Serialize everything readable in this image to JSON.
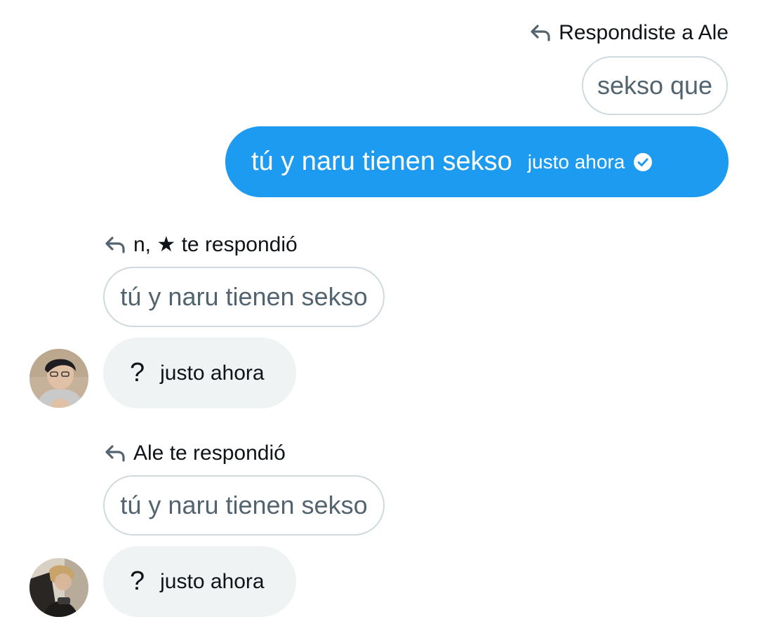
{
  "outgoing": {
    "reply_label": "Respondiste a Ale",
    "quoted_text": "sekso que",
    "message": "tú y naru tienen sekso",
    "time": "justo ahora",
    "status_icon": "check-circle-icon"
  },
  "incoming": [
    {
      "reply_label": "n, ★ te respondió",
      "quoted_text": "tú y naru tienen sekso",
      "message": "?",
      "time": "justo ahora"
    },
    {
      "reply_label": "Ale te respondió",
      "quoted_text": "tú y naru tienen sekso",
      "message": "?",
      "time": "justo ahora"
    }
  ],
  "colors": {
    "accent": "#1d9bf0",
    "received_bubble": "#eff3f4",
    "quote_border": "#cfd9de",
    "secondary_text": "#536471"
  }
}
